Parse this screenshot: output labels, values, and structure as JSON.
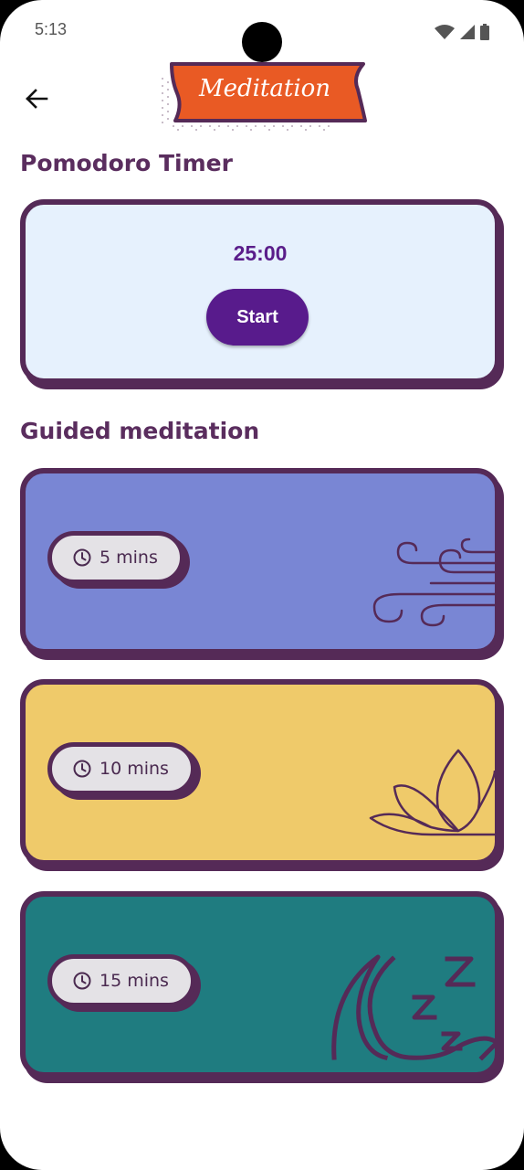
{
  "status_bar": {
    "time": "5:13"
  },
  "header": {
    "title": "Meditation"
  },
  "pomodoro": {
    "section_title": "Pomodoro Timer",
    "time": "25:00",
    "start_label": "Start"
  },
  "guided": {
    "section_title": "Guided meditation",
    "sessions": [
      {
        "duration": "5 mins",
        "color": "#7986d4",
        "icon": "wind-icon"
      },
      {
        "duration": "10 mins",
        "color": "#efca6a",
        "icon": "lotus-icon"
      },
      {
        "duration": "15 mins",
        "color": "#1f7c80",
        "icon": "sleep-moon-icon"
      }
    ]
  },
  "colors": {
    "accent": "#581b8c",
    "outline": "#552a57",
    "banner": "#e95a24"
  }
}
